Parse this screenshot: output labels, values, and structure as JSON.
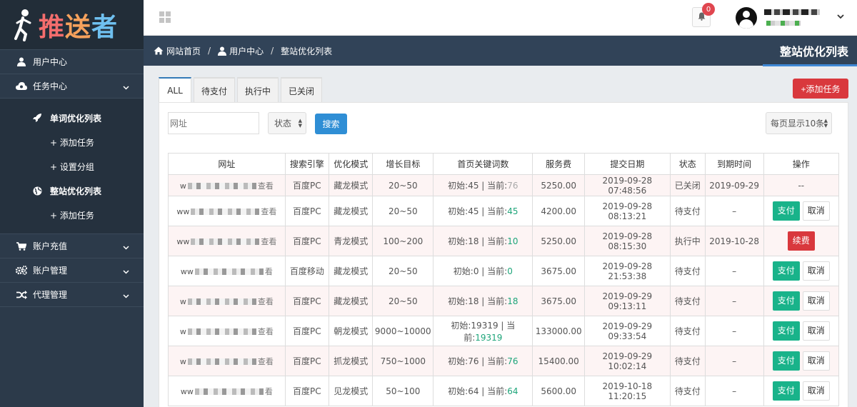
{
  "logo": {
    "c1": "推",
    "c2": "送",
    "c3": "者"
  },
  "sidebar": {
    "user_center": "用户中心",
    "task_center": "任务中心",
    "single_list": "单词优化列表",
    "single_add": "+ 添加任务",
    "single_group": "+ 设置分组",
    "site_list": "整站优化列表",
    "site_add": "+ 添加任务",
    "recharge": "账户充值",
    "account_mgmt": "账户管理",
    "agent_mgmt": "代理管理"
  },
  "topbar": {
    "notification_count": "0"
  },
  "breadcrumb": {
    "home": "网站首页",
    "user_center": "用户中心",
    "current": "整站优化列表",
    "sep": "/",
    "title": "整站优化列表"
  },
  "tabs": [
    "ALL",
    "待支付",
    "执行中",
    "已关闭"
  ],
  "toolbar": {
    "add_task": "+添加任务",
    "search_placeholder": "网址",
    "status_label": "状态",
    "search_button": "搜索",
    "page_size": "每页显示10条"
  },
  "table": {
    "headers": [
      "网址",
      "搜索引擎",
      "优化模式",
      "增长目标",
      "首页关键词数",
      "服务费",
      "提交日期",
      "状态",
      "到期时间",
      "操作"
    ],
    "rows": [
      {
        "url_prefix": "w",
        "view": "查看",
        "engine": "百度PC",
        "mode": "藏龙模式",
        "target": "20~50",
        "init": "初始:45 | 当前:",
        "current": "76",
        "fee": "5250.00",
        "date": "2019-09-28 07:48:56",
        "status": "已关闭",
        "expire": "2019-09-29",
        "action": "renew_none",
        "action_text": "--"
      },
      {
        "url_prefix": "ww",
        "view": "查看",
        "engine": "百度PC",
        "mode": "藏龙模式",
        "target": "20~50",
        "init": "初始:45 | 当前:",
        "current": "45",
        "fee": "4200.00",
        "date": "2019-09-28 08:13:21",
        "status": "待支付",
        "expire": "–",
        "action": "pay"
      },
      {
        "url_prefix": "ww",
        "view": "查看",
        "engine": "百度PC",
        "mode": "青龙模式",
        "target": "100~200",
        "init": "初始:18 | 当前:",
        "current": "10",
        "fee": "5250.00",
        "date": "2019-09-28 08:15:30",
        "status": "执行中",
        "expire": "2019-10-28",
        "action": "renew"
      },
      {
        "url_prefix": "ww",
        "view": "看",
        "engine": "百度移动",
        "mode": "藏龙模式",
        "target": "20~50",
        "init": "初始:0 | 当前:",
        "current": "0",
        "fee": "3675.00",
        "date": "2019-09-28 21:53:38",
        "status": "待支付",
        "expire": "–",
        "action": "pay"
      },
      {
        "url_prefix": "w",
        "view": "查看",
        "engine": "百度PC",
        "mode": "藏龙模式",
        "target": "20~50",
        "init": "初始:18 | 当前:",
        "current": "18",
        "fee": "3675.00",
        "date": "2019-09-29 09:13:11",
        "status": "待支付",
        "expire": "–",
        "action": "pay"
      },
      {
        "url_prefix": "w",
        "view": "查看",
        "engine": "百度PC",
        "mode": "朝龙模式",
        "target": "9000~10000",
        "init": "初始:19319 | 当前:",
        "current": "19319",
        "fee": "133000.00",
        "date": "2019-09-29 09:33:54",
        "status": "待支付",
        "expire": "–",
        "action": "pay"
      },
      {
        "url_prefix": "w",
        "view": "查看",
        "engine": "百度PC",
        "mode": "抓龙模式",
        "target": "750~1000",
        "init": "初始:76 | 当前:",
        "current": "76",
        "fee": "15400.00",
        "date": "2019-09-29 10:02:14",
        "status": "待支付",
        "expire": "–",
        "action": "pay"
      },
      {
        "url_prefix": "ww",
        "view": "看",
        "engine": "百度PC",
        "mode": "见龙模式",
        "target": "50~100",
        "init": "初始:64 | 当前:",
        "current": "64",
        "fee": "5600.00",
        "date": "2019-10-18 11:20:15",
        "status": "待支付",
        "expire": "–",
        "action": "pay"
      }
    ],
    "pay_label": "支付",
    "cancel_label": "取消",
    "renew_label": "续费"
  },
  "colors": {
    "sidebar": "#2c3a4a",
    "breadcrumb": "#314358",
    "accent_red": "#d9383d",
    "accent_green": "#19b38a",
    "accent_blue": "#2f8ed5"
  }
}
